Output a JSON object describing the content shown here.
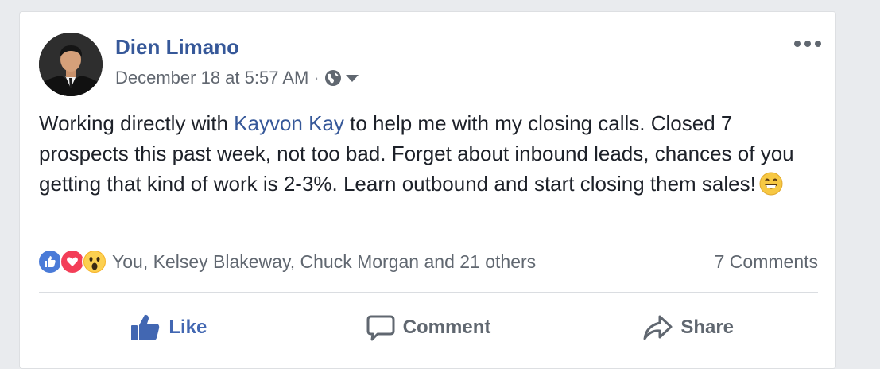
{
  "post": {
    "author": "Dien Limano",
    "timestamp": "December 18 at 5:57 AM",
    "separator": "·",
    "privacy_icon": "globe-icon",
    "text_before_mention": "Working directly with ",
    "mention": "Kayvon Kay",
    "text_after_mention": " to help me with my closing calls. Closed 7 prospects this past week, not too bad. Forget about inbound leads, chances of you getting that kind of work is 2-3%. Learn outbound and start closing them sales!",
    "emoji": "grinning-face-emoji"
  },
  "reactions": {
    "icons": [
      "like-reaction-icon",
      "love-reaction-icon",
      "wow-reaction-icon"
    ],
    "summary": "You, Kelsey Blakeway, Chuck Morgan and 21 others",
    "comments": "7 Comments"
  },
  "actions": {
    "like_label": "Like",
    "comment_label": "Comment",
    "share_label": "Share"
  },
  "colors": {
    "link": "#365899",
    "like_active": "#4267b2",
    "love": "#f33e58",
    "wow": "#f7b125",
    "muted": "#606770"
  }
}
